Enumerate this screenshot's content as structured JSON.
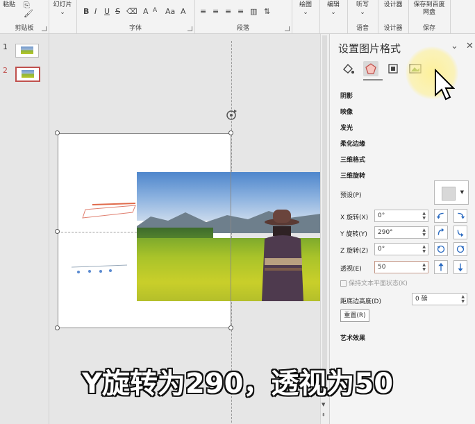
{
  "ribbon": {
    "clipboard": {
      "paste_label": "粘贴",
      "group_label": "剪贴板"
    },
    "slides": {
      "label": "幻灯片"
    },
    "font": {
      "group_label": "字体",
      "bold": "B",
      "italic": "I",
      "underline": "U",
      "strike": "S",
      "grow": "A",
      "shrink": "A",
      "aa": "Aa"
    },
    "paragraph": {
      "group_label": "段落"
    },
    "drawing": {
      "label": "绘图"
    },
    "editing": {
      "label": "编辑"
    },
    "voice": {
      "dictate_label": "听写",
      "group_label": "语音"
    },
    "designer": {
      "btn_label": "设计器",
      "group_label": "设计器"
    },
    "save": {
      "btn_label": "保存到百度网盘",
      "group_label": "保存"
    }
  },
  "slides": [
    {
      "number": "1"
    },
    {
      "number": "2"
    }
  ],
  "panel": {
    "title": "设置图片格式",
    "collapse_icon": "chevron-down-icon",
    "close_icon": "close-icon",
    "sections": [
      "阴影",
      "映像",
      "发光",
      "柔化边缘",
      "三维格式",
      "三维旋转"
    ],
    "preset_label": "预设(P)",
    "x_rotation": {
      "label": "X 旋转(X)",
      "value": "0°"
    },
    "y_rotation": {
      "label": "Y 旋转(Y)",
      "value": "290°"
    },
    "z_rotation": {
      "label": "Z 旋转(Z)",
      "value": "0°"
    },
    "perspective": {
      "label": "透视(E)",
      "value": "50"
    },
    "keep_text_flat": "保持文本平面状态(K)",
    "distance_label": "距底边高度(D)",
    "distance_value": "0 磅",
    "reset_label": "重置(R)",
    "artistic_effects": "艺术效果"
  },
  "caption": "Y旋转为290，透视为50",
  "colors": {
    "accent": "#c0504d",
    "highlight": "#fff08c"
  }
}
